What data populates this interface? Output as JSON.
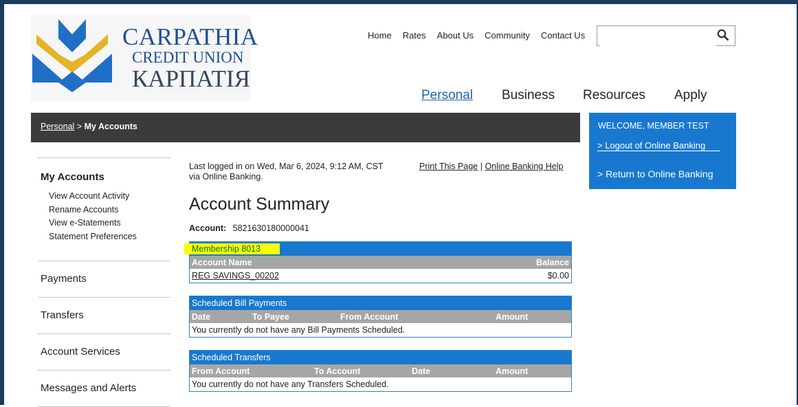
{
  "logo": {
    "line1": "CARPATHIA",
    "line2": "CREDIT UNION",
    "line3": "КАРПАТІЯ"
  },
  "topnav": [
    "Home",
    "Rates",
    "About Us",
    "Community",
    "Contact Us"
  ],
  "search": {
    "value": "",
    "placeholder": ""
  },
  "mainnav": {
    "personal": "Personal",
    "business": "Business",
    "resources": "Resources",
    "apply": "Apply"
  },
  "breadcrumb": {
    "parent": "Personal",
    "separator": ">",
    "current": "My Accounts"
  },
  "welcome": {
    "title": "WELCOME, MEMBER TEST",
    "logout": "> Logout of Online Banking",
    "return": "> Return to Online Banking"
  },
  "sidebar": {
    "my_accounts": "My Accounts",
    "sub": [
      "View Account Activity",
      "Rename Accounts",
      "View e-Statements",
      "Statement Preferences"
    ],
    "payments": "Payments",
    "transfers": "Transfers",
    "account_services": "Account Services",
    "messages": "Messages and Alerts"
  },
  "content": {
    "last_login_1": "Last logged in on Wed, Mar 6, 2024, 9:12 AM, CST",
    "last_login_2": "via Online Banking.",
    "print": "Print This Page",
    "link_sep": "|",
    "help": "Online Banking Help",
    "heading": "Account Summary",
    "account_label": "Account:",
    "account_number": "5821630180000041"
  },
  "membership": {
    "title": "Membership 8013",
    "col_name": "Account Name",
    "col_balance": "Balance",
    "rows": [
      {
        "name": "REG SAVINGS_00202",
        "balance": "$0.00"
      }
    ]
  },
  "bill_payments": {
    "title": "Scheduled Bill Payments",
    "cols": [
      "Date",
      "To Payee",
      "From Account",
      "Amount"
    ],
    "empty": "You currently do not have any Bill Payments Scheduled."
  },
  "transfers": {
    "title": "Scheduled Transfers",
    "cols": [
      "From Account",
      "To Account",
      "Date",
      "Amount"
    ],
    "empty": "You currently do not have any Transfers Scheduled."
  },
  "colors": {
    "brand_blue": "#1878cf",
    "dark_bar": "#3b3b3b",
    "header_gray": "#a6a6a6",
    "highlight": "#f7ff00"
  }
}
